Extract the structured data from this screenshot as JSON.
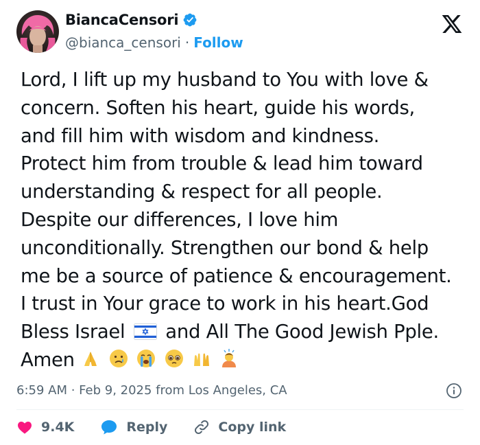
{
  "author": {
    "display_name": "BiancaCensori",
    "handle": "@bianca_censori",
    "separator": "·",
    "follow_label": "Follow",
    "verified": true
  },
  "brand_icon": "x-logo-icon",
  "tweet": {
    "lines": [
      "Lord, I lift up my husband to You with love &",
      "concern. Soften his heart, guide his words,",
      "and fill him with wisdom and kindness.",
      "Protect him from trouble & lead him toward",
      "understanding & respect for all people.",
      "Despite our differences, I love him",
      "unconditionally. Strengthen our bond & help",
      "me be a source of patience & encouragement.",
      "I trust in Your grace to work in his heart.God"
    ],
    "line10_before_flag": "Bless Israel",
    "line10_after_flag": "and All The Good Jewish Pple.",
    "line11_text": "Amen",
    "emojis": [
      "folded-hands-emoji",
      "crying-face-emoji",
      "loudly-crying-face-emoji",
      "pleading-face-emoji",
      "raising-hands-emoji",
      "person-bowing-emoji"
    ]
  },
  "meta": {
    "text": "6:59 AM · Feb 9, 2025 from Los Angeles, CA"
  },
  "actions": {
    "like_count": "9.4K",
    "reply_label": "Reply",
    "copy_link_label": "Copy link"
  },
  "colors": {
    "accent": "#1d9bf0",
    "like": "#f91880",
    "muted": "#536471",
    "text": "#0f1419"
  }
}
